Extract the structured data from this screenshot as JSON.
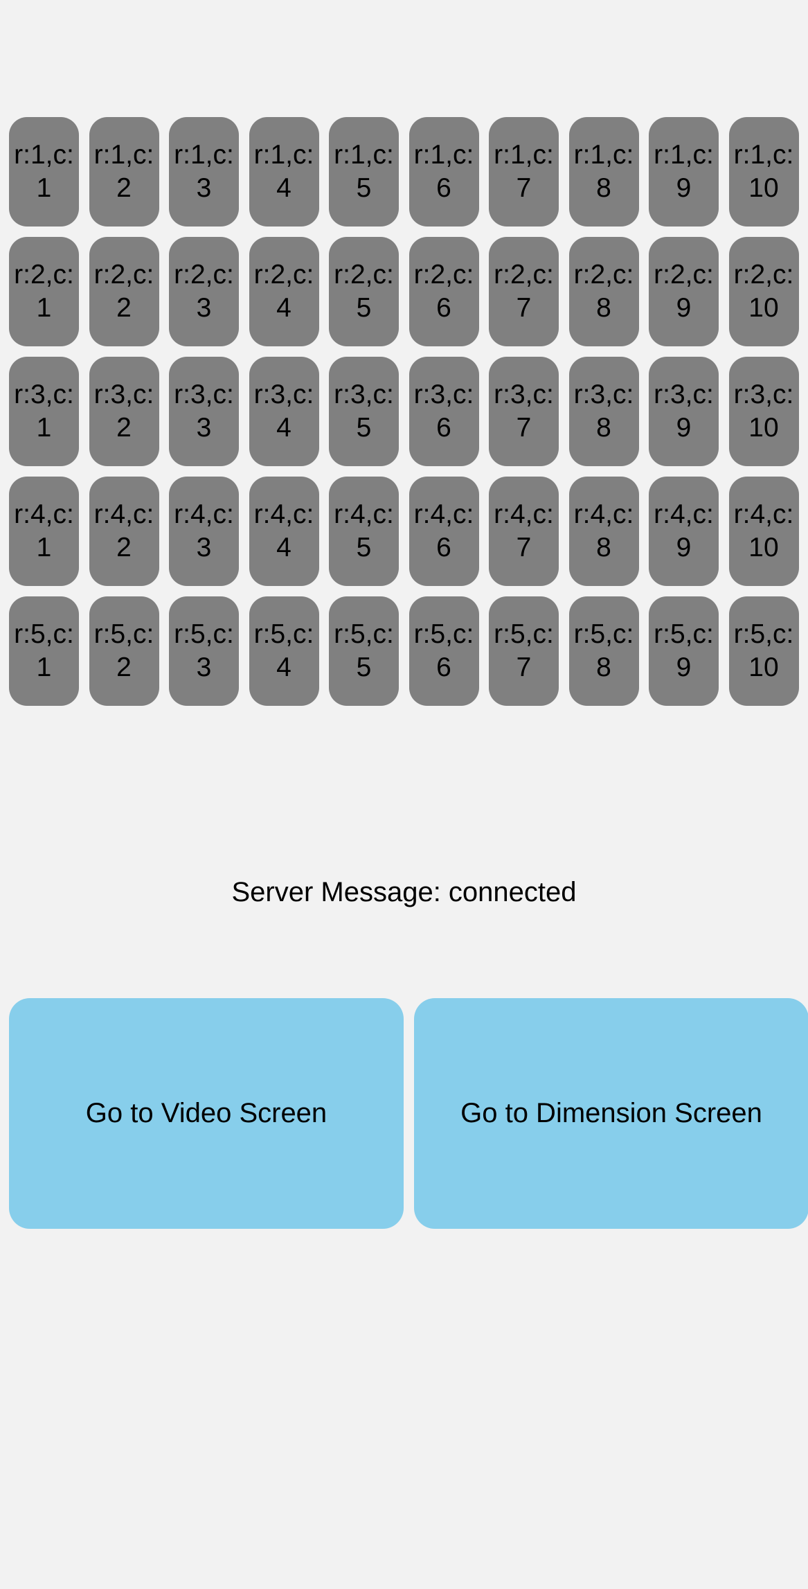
{
  "grid": {
    "rows": 5,
    "cols": 10,
    "cell_color": "#808080",
    "label_format": "r:{r},c:\n{c}"
  },
  "server_message": "Server Message: connected",
  "buttons": {
    "video": "Go to Video Screen",
    "dimension": "Go to Dimension Screen",
    "color": "#87ceeb"
  }
}
